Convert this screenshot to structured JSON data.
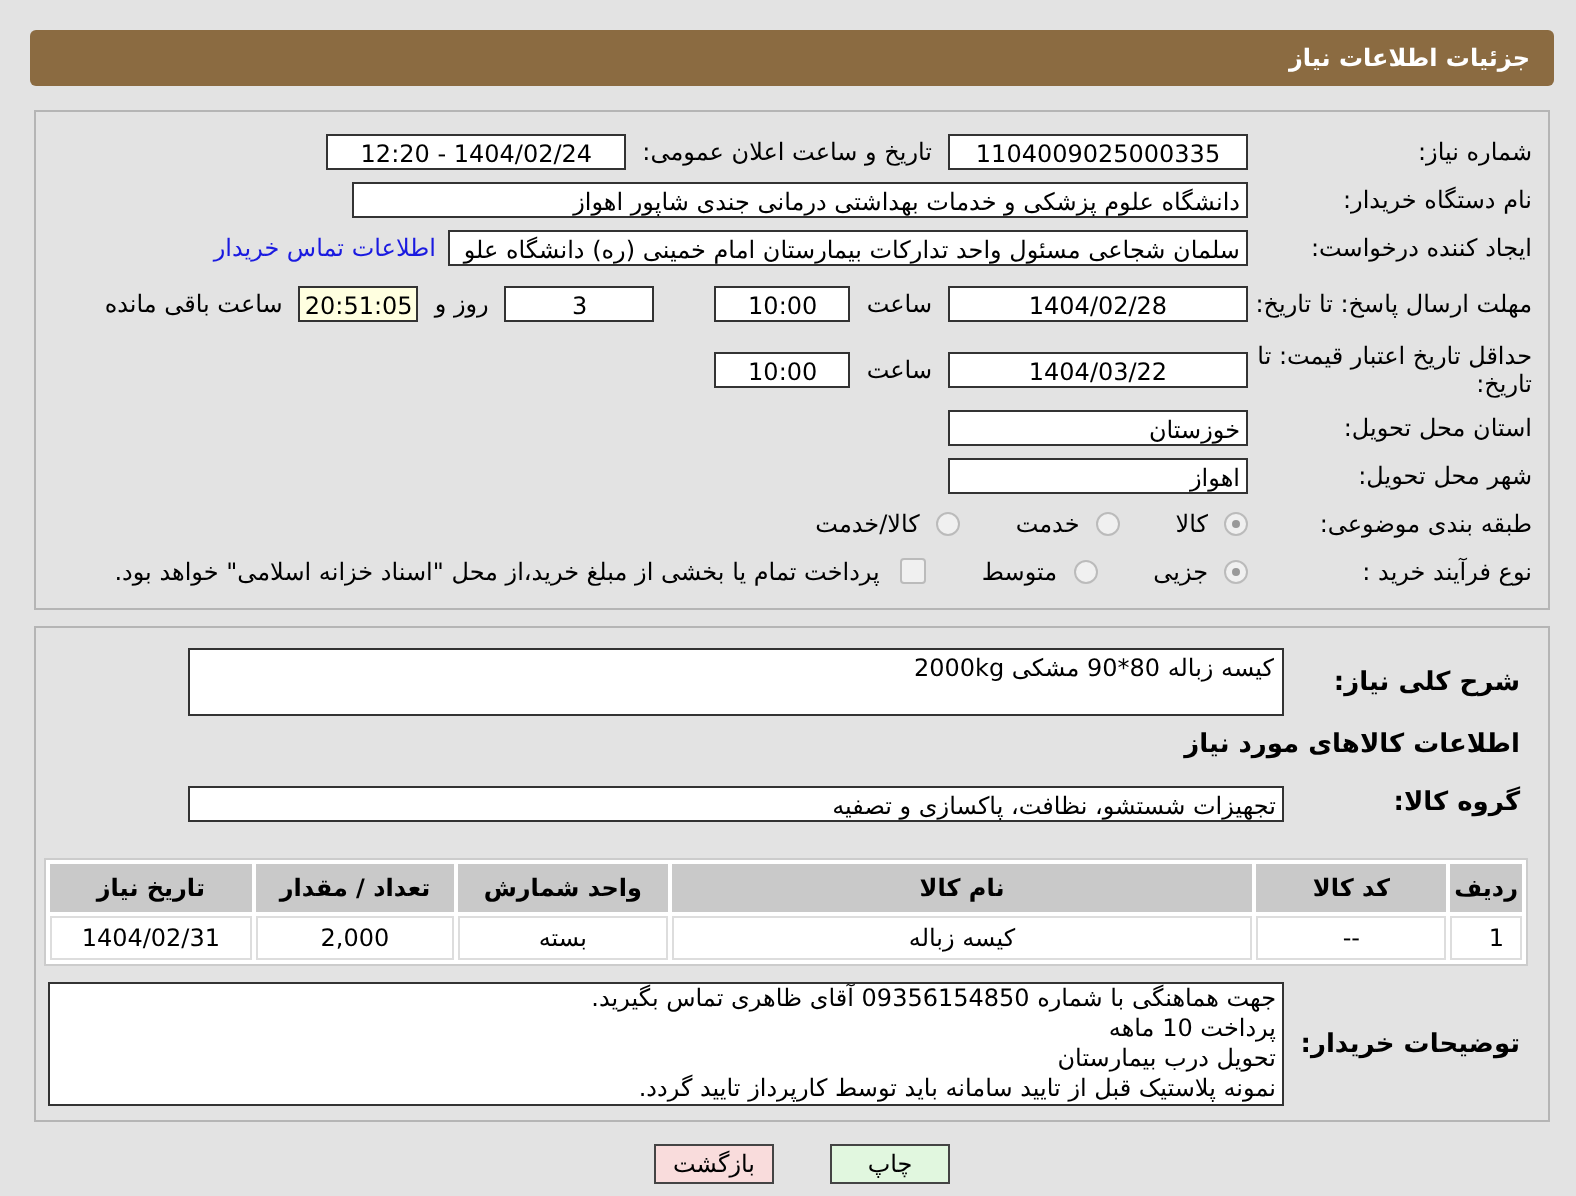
{
  "header": {
    "title": "جزئیات اطلاعات نیاز"
  },
  "need_number": {
    "label": "شماره نیاز:",
    "value": "1104009025000335"
  },
  "announce": {
    "label": "تاریخ و ساعت اعلان عمومی:",
    "value": "1404/02/24 - 12:20"
  },
  "buyer_org": {
    "label": "نام دستگاه خریدار:",
    "value": "دانشگاه علوم پزشکی و خدمات بهداشتی درمانی جندی شاپور اهواز"
  },
  "requester": {
    "label": "ایجاد کننده درخواست:",
    "value": "سلمان شجاعی مسئول واحد تدارکات بیمارستان امام خمینی (ره) دانشگاه علو",
    "link": "اطلاعات تماس خریدار"
  },
  "response_deadline": {
    "label": "مهلت ارسال پاسخ: تا تاریخ:",
    "date": "1404/02/28",
    "time_label": "ساعت",
    "time": "10:00",
    "days": "3",
    "days_label": "روز و",
    "remaining": "20:51:05",
    "remaining_label": "ساعت باقی مانده"
  },
  "price_validity": {
    "label": "حداقل تاریخ اعتبار قیمت: تا تاریخ:",
    "date": "1404/03/22",
    "time_label": "ساعت",
    "time": "10:00"
  },
  "province": {
    "label": "استان محل تحویل:",
    "value": "خوزستان"
  },
  "city": {
    "label": "شهر محل تحویل:",
    "value": "اهواز"
  },
  "category": {
    "label": "طبقه بندی موضوعی:",
    "options": [
      {
        "label": "کالا",
        "selected": true
      },
      {
        "label": "خدمت",
        "selected": false
      },
      {
        "label": "کالا/خدمت",
        "selected": false
      }
    ]
  },
  "process": {
    "label": "نوع فرآیند خرید :",
    "options": [
      {
        "label": "جزیی",
        "selected": true
      },
      {
        "label": "متوسط",
        "selected": false
      }
    ],
    "payment": {
      "checked": false,
      "label": "پرداخت تمام یا بخشی از مبلغ خرید،از محل \"اسناد خزانه اسلامی\" خواهد بود."
    }
  },
  "description": {
    "label": "شرح کلی نیاز:",
    "value": "کیسه زباله 80*90 مشکی   2000kg"
  },
  "goods_heading": "اطلاعات کالاهای مورد نیاز",
  "goods_group": {
    "label": "گروه کالا:",
    "value": "تجهیزات شستشو، نظافت، پاکسازی و تصفیه"
  },
  "table": {
    "columns": [
      "ردیف",
      "کد کالا",
      "نام کالا",
      "واحد شمارش",
      "تعداد / مقدار",
      "تاریخ نیاز"
    ],
    "rows": [
      [
        "1",
        "--",
        "کیسه زباله",
        "بسته",
        "2,000",
        "1404/02/31"
      ]
    ]
  },
  "buyer_notes": {
    "label": "توضیحات خریدار:",
    "lines": [
      "جهت هماهنگی با شماره 09356154850 آقای ظاهری تماس بگیرید.",
      "پرداخت 10 ماهه",
      "تحویل درب بیمارستان",
      "نمونه پلاستیک قبل از تایید سامانه باید توسط کارپرداز تایید گردد."
    ]
  },
  "buttons": [
    {
      "label": "چاپ",
      "kind": "print"
    },
    {
      "label": "بازگشت",
      "kind": "back"
    }
  ]
}
